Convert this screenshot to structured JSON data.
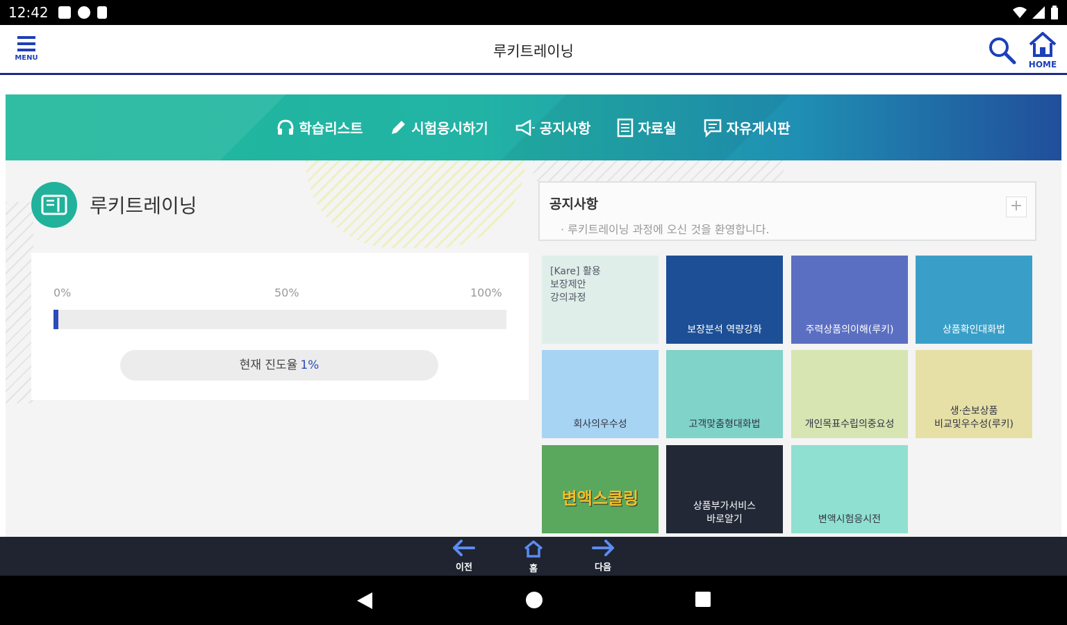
{
  "status_bar": {
    "time": "12:42"
  },
  "header": {
    "menu_label": "MENU",
    "title": "루키트레이닝",
    "home_label": "HOME"
  },
  "nav": {
    "items": [
      {
        "label": "학습리스트",
        "icon": "headset-icon"
      },
      {
        "label": "시험응시하기",
        "icon": "pencil-icon"
      },
      {
        "label": "공지사항",
        "icon": "megaphone-icon"
      },
      {
        "label": "자료실",
        "icon": "document-icon"
      },
      {
        "label": "자유게시판",
        "icon": "chat-icon"
      }
    ]
  },
  "course": {
    "title": "루키트레이닝",
    "progress": {
      "label_min": "0%",
      "label_mid": "50%",
      "label_max": "100%",
      "value_percent": 1,
      "current_label": "현재 진도율",
      "current_value": "1%"
    }
  },
  "notice": {
    "title": "공지사항",
    "text": "· 루키트레이닝 과정에 오신 것을 환영합니다.",
    "more": "+"
  },
  "tiles": [
    {
      "caption": "[Kare] 활용\n보장제안\n강의과정",
      "bg": "#dfeee9"
    },
    {
      "caption": "보장분석 역량강화",
      "bg": "#1d4f96"
    },
    {
      "caption": "주력상품의이해(루키)",
      "bg": "#5b6fc2"
    },
    {
      "caption": "상품확인대화법",
      "bg": "#3a9fc8"
    },
    {
      "caption": "회사의우수성",
      "bg": "#a7d4f2"
    },
    {
      "caption": "고객맞춤형대화법",
      "bg": "#7fd3c8"
    },
    {
      "caption": "개인목표수립의중요성",
      "bg": "#d6e5b2"
    },
    {
      "caption": "생·손보상품\n비교및우수성(루키)",
      "bg": "#e6e0a6"
    },
    {
      "caption": "변액스쿨링",
      "bg": "#5aa75e"
    },
    {
      "caption": "상품부가서비스\n바로알기",
      "bg": "#232836"
    },
    {
      "caption": "변액시험응시전",
      "bg": "#8fe0d0"
    }
  ],
  "bottom_nav": {
    "prev": "이전",
    "home": "홈",
    "next": "다음"
  },
  "colors": {
    "accent_blue": "#2a4bb8",
    "teal": "#20b29b",
    "header_line": "#1c2a8a"
  }
}
